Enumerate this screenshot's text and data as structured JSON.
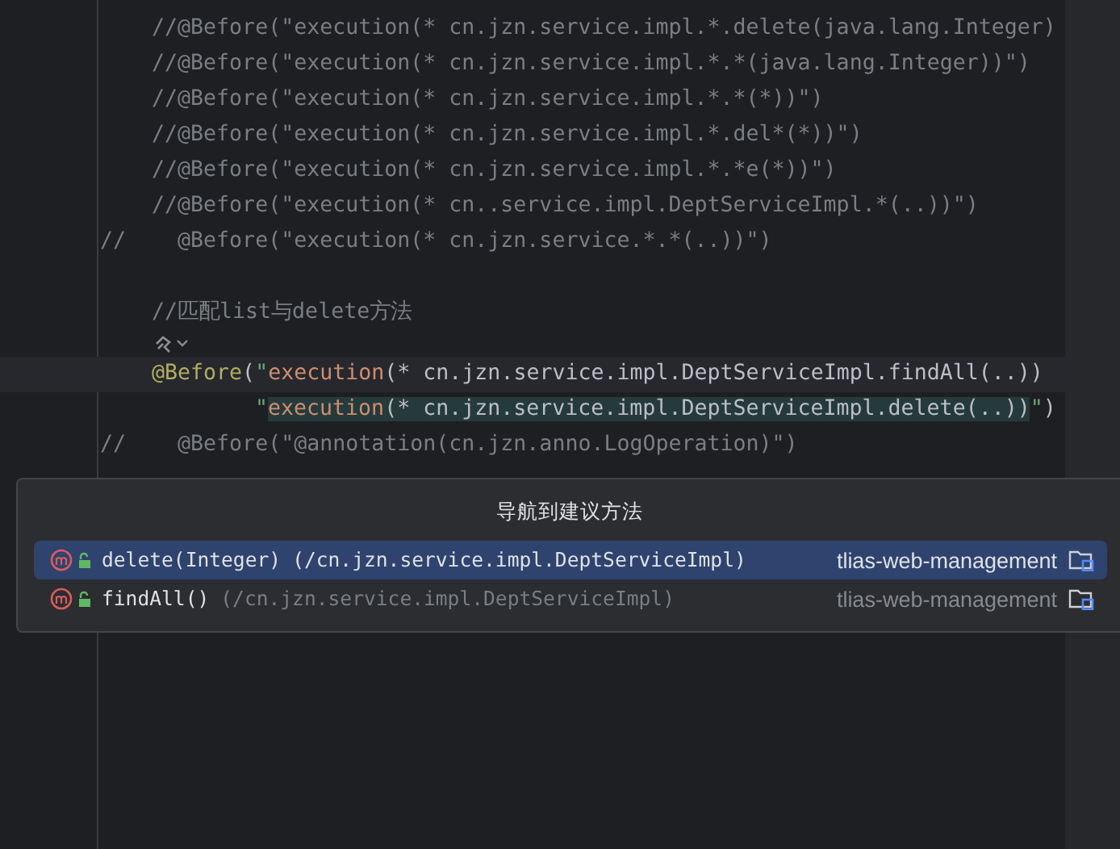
{
  "editor": {
    "lines": [
      {
        "kind": "code",
        "current": false,
        "segments": [
          {
            "text": "    //@Before(\"execution(* cn.jzn.service.impl.*.delete(java.lang.Integer)",
            "kind": "comment"
          }
        ]
      },
      {
        "kind": "code",
        "current": false,
        "segments": [
          {
            "text": "    //@Before(\"execution(* cn.jzn.service.impl.*.*(java.lang.Integer))\")",
            "kind": "comment"
          }
        ]
      },
      {
        "kind": "code",
        "current": false,
        "segments": [
          {
            "text": "    //@Before(\"execution(* cn.jzn.service.impl.*.*(*))\")",
            "kind": "comment"
          }
        ]
      },
      {
        "kind": "code",
        "current": false,
        "segments": [
          {
            "text": "    //@Before(\"execution(* cn.jzn.service.impl.*.del*(*))\")",
            "kind": "comment"
          }
        ]
      },
      {
        "kind": "code",
        "current": false,
        "segments": [
          {
            "text": "    //@Before(\"execution(* cn.jzn.service.impl.*.*e(*))\")",
            "kind": "comment"
          }
        ]
      },
      {
        "kind": "code",
        "current": false,
        "segments": [
          {
            "text": "    //@Before(\"execution(* cn..service.impl.DeptServiceImpl.*(..))\")",
            "kind": "comment"
          }
        ]
      },
      {
        "kind": "code",
        "current": false,
        "segments": [
          {
            "text": "//    @Before(\"execution(* cn.jzn.service.*.*(..))\")",
            "kind": "comment"
          }
        ]
      },
      {
        "kind": "blank"
      },
      {
        "kind": "code",
        "current": false,
        "segments": [
          {
            "text": "    //匹配list与delete方法",
            "kind": "comment"
          }
        ]
      },
      {
        "kind": "inlay"
      },
      {
        "kind": "indented",
        "current": true,
        "segments": [
          {
            "text": "@Before",
            "kind": "annotation"
          },
          {
            "text": "(",
            "kind": "plain"
          },
          {
            "text": "\"",
            "kind": "string"
          },
          {
            "text": "execution",
            "kind": "keyword"
          },
          {
            "text": "(* cn.jzn.service.impl.DeptServiceImpl.findAll(..))",
            "kind": "plain"
          }
        ]
      },
      {
        "kind": "continuation",
        "current": false,
        "segments": [
          {
            "text": "\"",
            "kind": "string",
            "highlighted": false
          },
          {
            "text": "execution",
            "kind": "keyword",
            "highlighted": true
          },
          {
            "text": "(* cn.jzn.service.impl.DeptServiceImpl.delete(..))",
            "kind": "plain",
            "highlighted": true
          },
          {
            "text": "\"",
            "kind": "string",
            "highlighted": false
          },
          {
            "text": ")",
            "kind": "plain",
            "highlighted": false
          }
        ]
      },
      {
        "kind": "code",
        "current": false,
        "segments": [
          {
            "text": "//    @Before(\"@annotation(cn.jzn.anno.LogOperation)\")",
            "kind": "comment"
          }
        ]
      }
    ]
  },
  "popup": {
    "title": "导航到建议方法",
    "items": [
      {
        "method": "delete(Integer)",
        "location": "(/cn.jzn.service.impl.DeptServiceImpl)",
        "module": "tlias-web-management",
        "selected": true
      },
      {
        "method": "findAll()",
        "location": "(/cn.jzn.service.impl.DeptServiceImpl)",
        "module": "tlias-web-management",
        "selected": false
      }
    ]
  }
}
